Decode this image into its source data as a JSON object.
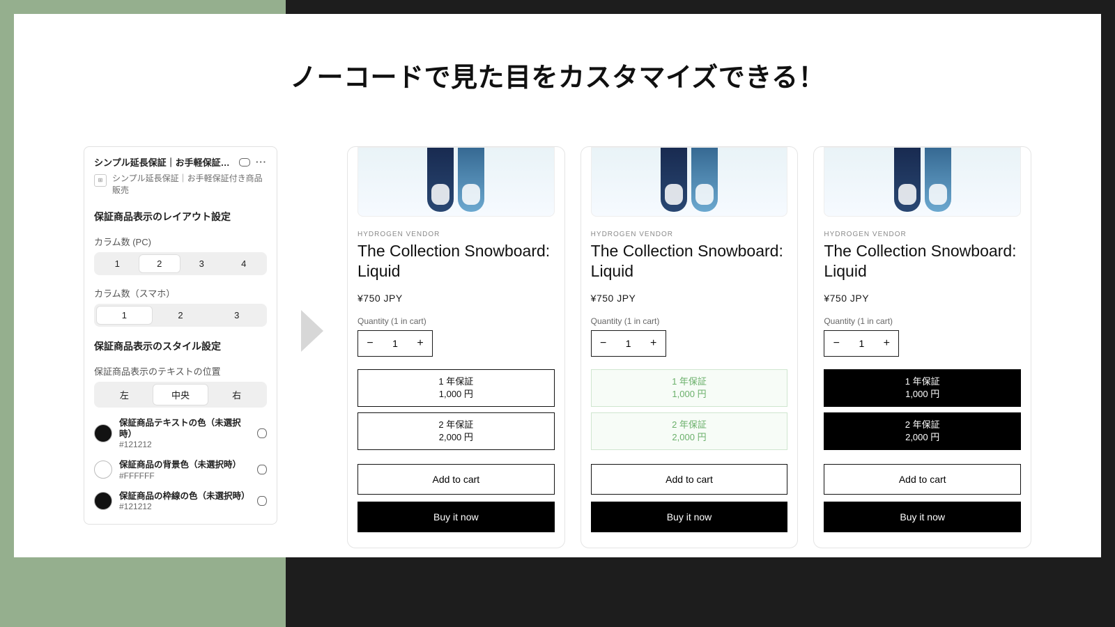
{
  "title": "ノーコードで見た目をカスタマイズできる！",
  "settings": {
    "header": "シンプル延長保証｜お手軽保証…",
    "subheader": "シンプル延長保証｜お手軽保証付き商品販売",
    "section_layout": "保証商品表示のレイアウト設定",
    "columns_pc": {
      "label": "カラム数 (PC)",
      "options": [
        "1",
        "2",
        "3",
        "4"
      ],
      "selected": "2"
    },
    "columns_sp": {
      "label": "カラム数（スマホ）",
      "options": [
        "1",
        "2",
        "3"
      ],
      "selected": "1"
    },
    "section_style": "保証商品表示のスタイル設定",
    "text_pos": {
      "label": "保証商品表示のテキストの位置",
      "options": [
        "左",
        "中央",
        "右"
      ],
      "selected": "中央"
    },
    "colors": [
      {
        "name": "保証商品テキストの色（未選択時）",
        "hex": "#121212",
        "swatch": "#121212"
      },
      {
        "name": "保証商品の背景色（未選択時）",
        "hex": "#FFFFFF",
        "swatch": "#FFFFFF"
      },
      {
        "name": "保証商品の枠線の色（未選択時）",
        "hex": "#121212",
        "swatch": "#121212"
      }
    ]
  },
  "product": {
    "vendor": "HYDROGEN VENDOR",
    "title": "The Collection Snowboard: Liquid",
    "price": "¥750 JPY",
    "qty_label": "Quantity (1 in cart)",
    "qty_value": "1",
    "add_to_cart": "Add to cart",
    "buy_now": "Buy it now",
    "warranty1_label": "1 年保証",
    "warranty1_price": "1,000 円",
    "warranty2_label": "2 年保証",
    "warranty2_price": "2,000 円"
  },
  "variants": [
    {
      "box_class": "default"
    },
    {
      "box_class": "green"
    },
    {
      "box_class": "dark"
    }
  ]
}
